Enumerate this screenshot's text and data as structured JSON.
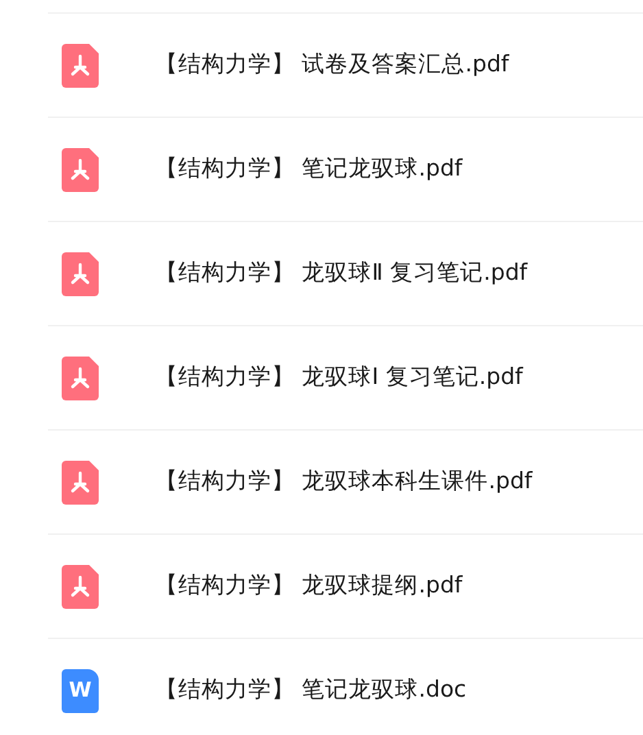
{
  "files": [
    {
      "kind": "pdf",
      "name": "【结构力学】 试卷及答案汇总.pdf"
    },
    {
      "kind": "pdf",
      "name": "【结构力学】 笔记龙驭球.pdf"
    },
    {
      "kind": "pdf",
      "name": "【结构力学】 龙驭球Ⅱ 复习笔记.pdf"
    },
    {
      "kind": "pdf",
      "name": "【结构力学】 龙驭球Ⅰ 复习笔记.pdf"
    },
    {
      "kind": "pdf",
      "name": "【结构力学】 龙驭球本科生课件.pdf"
    },
    {
      "kind": "pdf",
      "name": "【结构力学】 龙驭球提纲.pdf"
    },
    {
      "kind": "doc",
      "name": "【结构力学】 笔记龙驭球.doc",
      "icon_letter": "W"
    }
  ]
}
